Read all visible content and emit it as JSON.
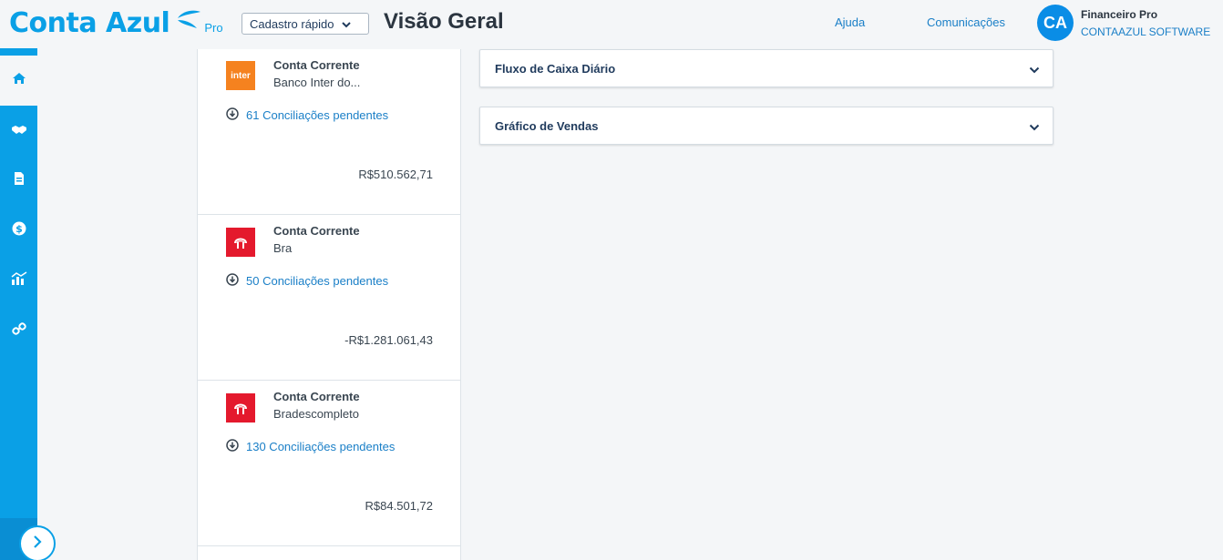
{
  "header": {
    "logo_text": "Conta Azul",
    "logo_pro": "Pro",
    "quick_button": "Cadastro rápido",
    "page_title": "Visão Geral",
    "nav": {
      "help": "Ajuda",
      "communications": "Comunicações"
    },
    "user": {
      "initials": "CA",
      "name": "Financeiro Pro",
      "company": "CONTAAZUL SOFTWARE"
    }
  },
  "sidebar": {
    "items": [
      {
        "name": "home-icon",
        "active": true
      },
      {
        "name": "handshake-icon",
        "active": false
      },
      {
        "name": "document-icon",
        "active": false
      },
      {
        "name": "dollar-icon",
        "active": false
      },
      {
        "name": "chart-icon",
        "active": false
      },
      {
        "name": "link-icon",
        "active": false
      }
    ],
    "expand_icon": "chevron-right-icon"
  },
  "accounts": [
    {
      "type": "Conta Corrente",
      "name": "Banco Inter do...",
      "logo_text": "inter",
      "pending": "61 Conciliações pendentes",
      "balance": "R$510.562,71"
    },
    {
      "type": "Conta Corrente",
      "name": "Bra",
      "logo_text": "",
      "pending": "50 Conciliações pendentes",
      "balance": "-R$1.281.061,43"
    },
    {
      "type": "Conta Corrente",
      "name": "Bradescompleto",
      "logo_text": "",
      "pending": "130 Conciliações pendentes",
      "balance": "R$84.501,72"
    }
  ],
  "panels": {
    "cash_flow": "Fluxo de Caixa Diário",
    "sales_chart": "Gráfico de Vendas"
  },
  "colors": {
    "brand": "#0aa0e6",
    "link": "#1a7fc7",
    "inter": "#f5821f",
    "bradesco": "#e4192d"
  }
}
